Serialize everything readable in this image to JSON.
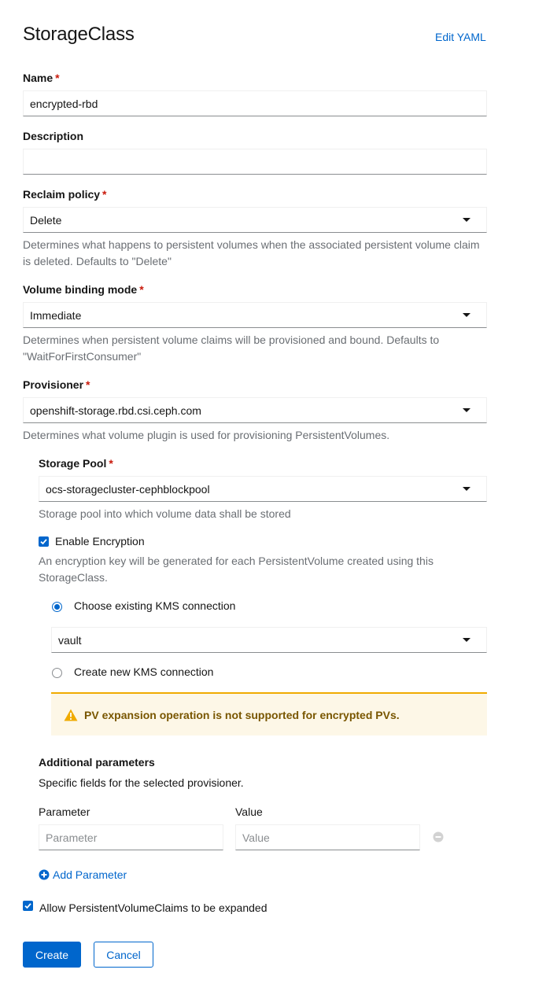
{
  "header": {
    "title": "StorageClass",
    "edit_yaml": "Edit YAML"
  },
  "required_marker": "*",
  "name": {
    "label": "Name",
    "value": "encrypted-rbd"
  },
  "description": {
    "label": "Description",
    "value": ""
  },
  "reclaim_policy": {
    "label": "Reclaim policy",
    "value": "Delete",
    "help": "Determines what happens to persistent volumes when the associated persistent volume claim is deleted. Defaults to \"Delete\""
  },
  "volume_binding_mode": {
    "label": "Volume binding mode",
    "value": "Immediate",
    "help": "Determines when persistent volume claims will be provisioned and bound. Defaults to \"WaitForFirstConsumer\""
  },
  "provisioner": {
    "label": "Provisioner",
    "value": "openshift-storage.rbd.csi.ceph.com",
    "help": "Determines what volume plugin is used for provisioning PersistentVolumes."
  },
  "storage_pool": {
    "label": "Storage Pool",
    "value": "ocs-storagecluster-cephblockpool",
    "help": "Storage pool into which volume data shall be stored"
  },
  "encryption": {
    "label": "Enable Encryption",
    "checked": true,
    "help": "An encryption key will be generated for each PersistentVolume created using this StorageClass."
  },
  "kms": {
    "existing_label": "Choose existing KMS connection",
    "existing_value": "vault",
    "new_label": "Create new KMS connection",
    "selected": "existing"
  },
  "alert": {
    "text": "PV expansion operation is not supported for encrypted PVs.",
    "color": "#f0ab00"
  },
  "additional": {
    "title": "Additional parameters",
    "subtitle": "Specific fields for the selected provisioner.",
    "param_header": "Parameter",
    "value_header": "Value",
    "param_placeholder": "Parameter",
    "value_placeholder": "Value",
    "add_label": "Add Parameter"
  },
  "allow_expansion": {
    "label": "Allow PersistentVolumeClaims to be expanded",
    "checked": true
  },
  "actions": {
    "create": "Create",
    "cancel": "Cancel"
  },
  "colors": {
    "accent": "#0066cc",
    "required": "#c9190b"
  }
}
